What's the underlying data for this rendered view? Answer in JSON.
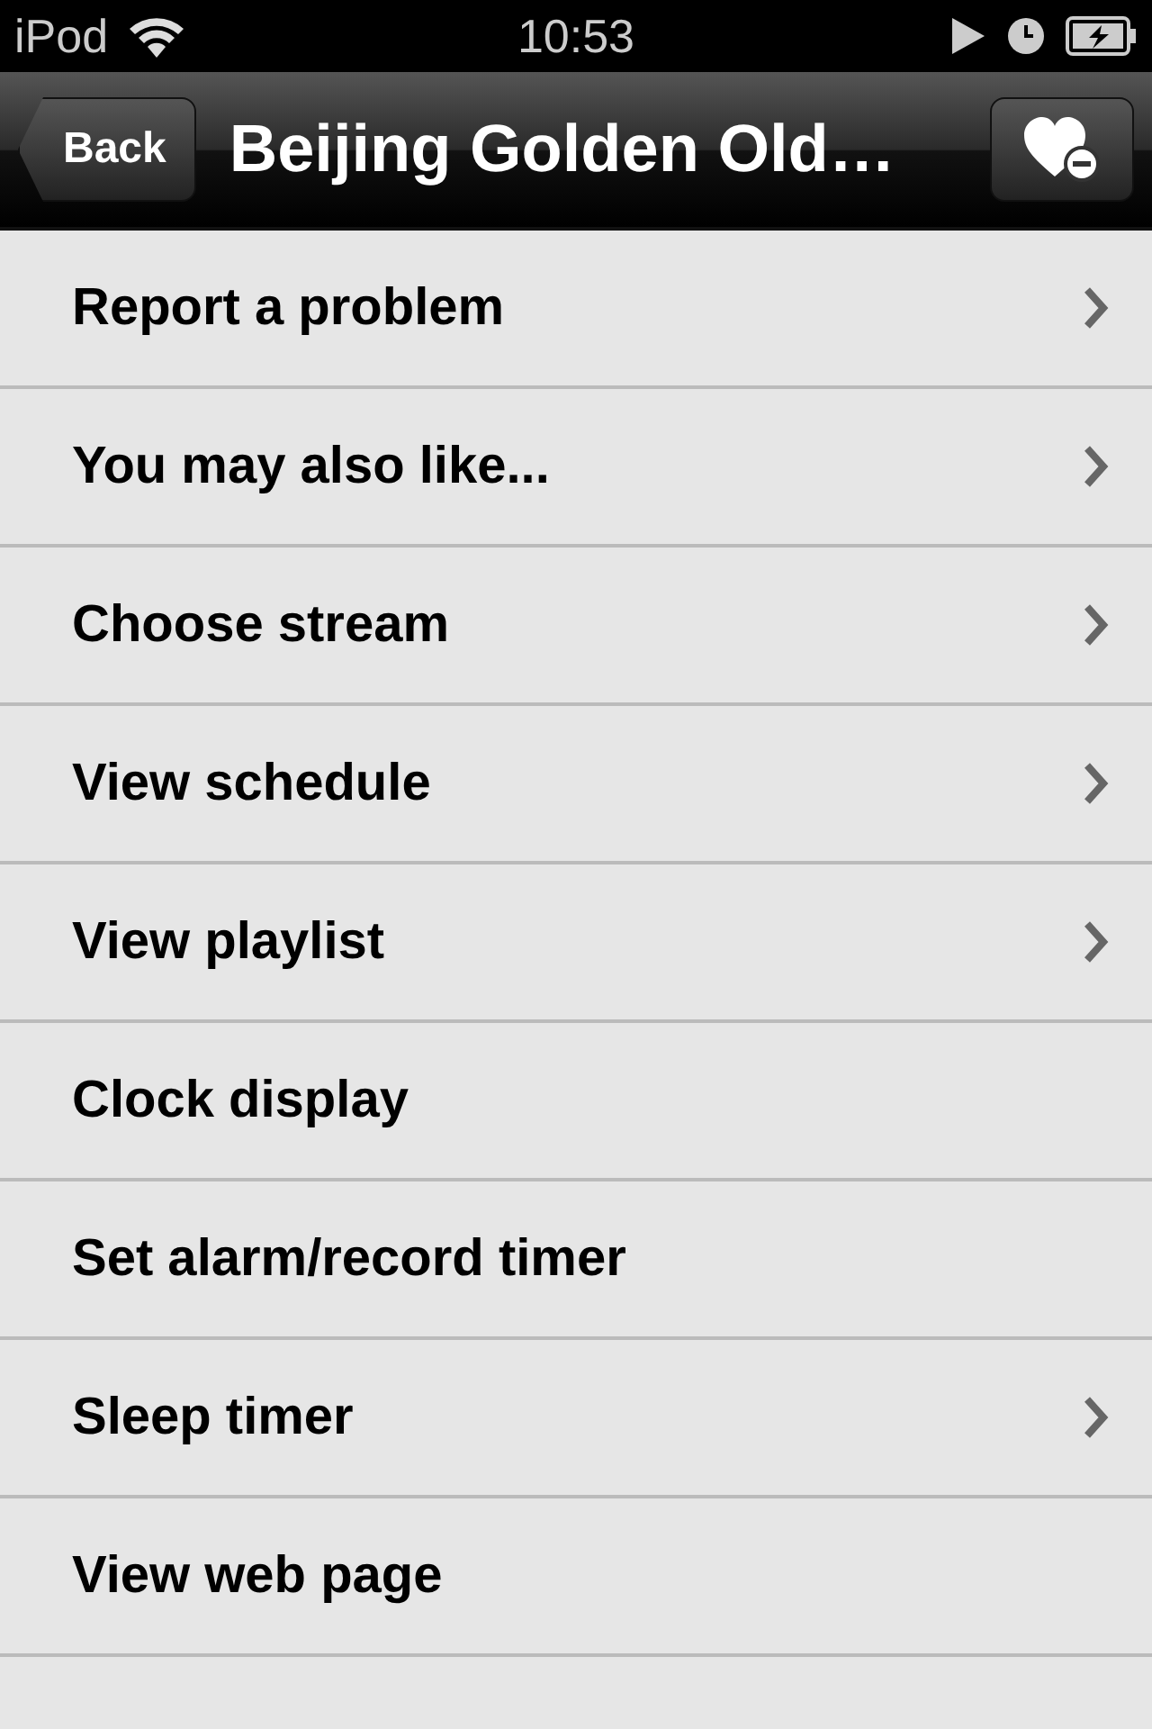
{
  "status_bar": {
    "carrier": "iPod",
    "time": "10:53"
  },
  "nav_bar": {
    "back_button": "Back",
    "title": "Beijing Golden Old…"
  },
  "menu_items": [
    {
      "label": "Report a problem",
      "chevron": true,
      "disabled": false
    },
    {
      "label": "You may also like...",
      "chevron": true,
      "disabled": false
    },
    {
      "label": "Choose stream",
      "chevron": true,
      "disabled": false
    },
    {
      "label": "View schedule",
      "chevron": true,
      "disabled": false
    },
    {
      "label": "View playlist",
      "chevron": true,
      "disabled": false
    },
    {
      "label": "Clock display",
      "chevron": false,
      "disabled": false
    },
    {
      "label": "Set alarm/record timer",
      "chevron": false,
      "disabled": false
    },
    {
      "label": "Sleep timer",
      "chevron": true,
      "disabled": false
    },
    {
      "label": "View web page",
      "chevron": false,
      "disabled": false
    }
  ]
}
